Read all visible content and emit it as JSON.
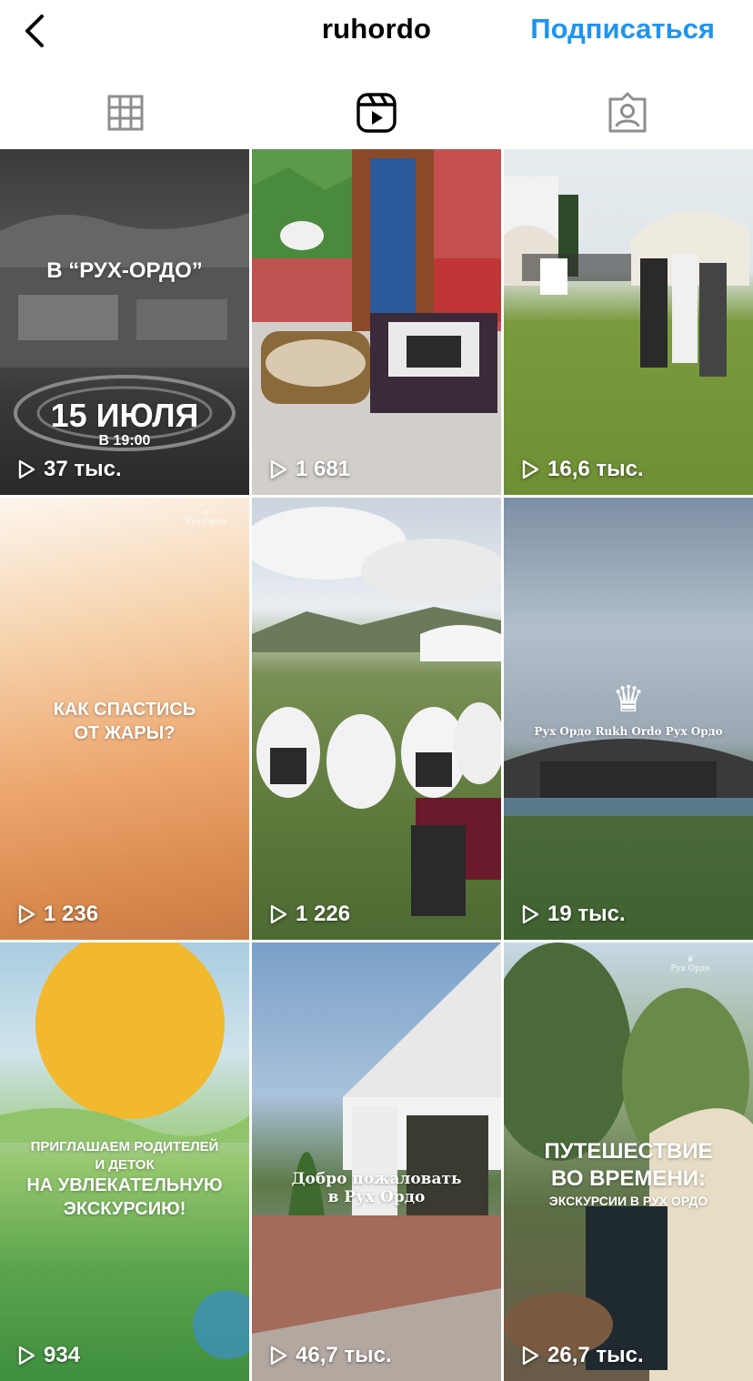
{
  "header": {
    "username": "ruhordo",
    "follow_label": "Подписаться"
  },
  "icons": {
    "back": "chevron-left-icon",
    "grid_tab": "grid-icon",
    "reels_tab": "reels-icon",
    "tagged_tab": "tagged-person-icon",
    "play": "play-icon"
  },
  "colors": {
    "accent": "#1e94f0",
    "active_tab": "#000000",
    "inactive_tab": "#8e8e8e"
  },
  "active_tab": "reels",
  "reels": [
    {
      "views": "37 тыс.",
      "lines": [
        "В “РУХ-ОРДО”",
        "15 ИЮЛЯ",
        "В 19:00"
      ]
    },
    {
      "views": "1 681",
      "lines": []
    },
    {
      "views": "16,6 тыс.",
      "lines": []
    },
    {
      "views": "1 236",
      "lines": [
        "КАК СПАСТИСЬ",
        "ОТ ЖАРЫ?"
      ]
    },
    {
      "views": "1 226",
      "lines": []
    },
    {
      "views": "19 тыс.",
      "lines": [
        "Рух Ордо Rukh Ordo Рух Ордо"
      ]
    },
    {
      "views": "934",
      "lines": [
        "ПРИГЛАШАЕМ РОДИТЕЛЕЙ",
        "И ДЕТОК",
        "НА УВЛЕКАТЕЛЬНУЮ",
        "ЭКСКУРСИЮ!"
      ]
    },
    {
      "views": "46,7 тыс.",
      "lines": [
        "Добро пожаловать",
        "в Рух Ордо"
      ]
    },
    {
      "views": "26,7 тыс.",
      "lines": [
        "ПУТЕШЕСТВИЕ",
        "ВО ВРЕМЕНИ:",
        "ЭКСКУРСИИ В РУХ ОРДО"
      ]
    }
  ]
}
